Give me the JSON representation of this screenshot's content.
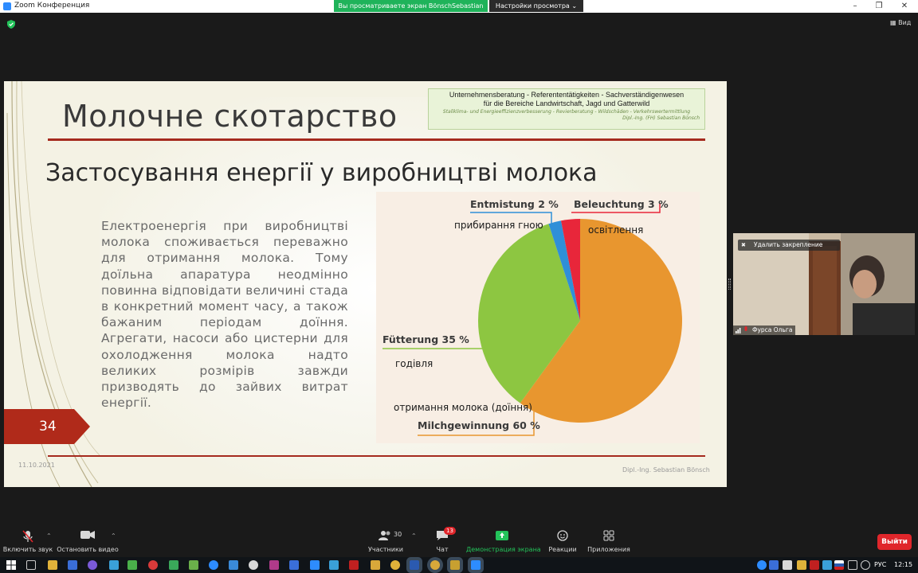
{
  "window": {
    "title": "Zoom Конференция",
    "share_banner": "Вы просматриваете экран BönschSebastian",
    "view_options": "Настройки просмотра",
    "view_label": "Вид"
  },
  "slide": {
    "title": "Молочне скотарство",
    "subtitle": "Застосування енергії у виробництві молока",
    "company": {
      "line1": "Unternehmensberatung  -  Referententätigkeiten  -  Sachverständigenwesen",
      "line2": "für die Bereiche Landwirtschaft, Jagd und Gatterwild",
      "line3": "Stallklima- und Energieeffizienzverbesserung - Revierberatung - Wildschäden - Verkehrswertermittlung",
      "line4": "Dipl.-Ing. (FH) Sebastian Bönsch"
    },
    "body": "Електроенергія при виробництві молока споживається переважно для отримання молока. Тому доїльна апаратура неодмінно повинна відповідати величині стада в конкретний момент часу, а також бажаним періодам доїння. Агрегати, насоси або цистерни для охолодження молока надто великих розмірів завжди призводять до зайвих витрат енергії.",
    "number": "34",
    "date": "11.10.2021",
    "author": "Dipl.-Ing. Sebastian Bönsch"
  },
  "chart_data": {
    "type": "pie",
    "slices": [
      {
        "label": "Milchgewinnung 60 %",
        "translation": "отримання молока (доїння)",
        "value": 60,
        "color": "#e8962f"
      },
      {
        "label": "Fütterung 35 %",
        "translation": "годівля",
        "value": 35,
        "color": "#8dc641"
      },
      {
        "label": "Entmistung  2 %",
        "translation": "прибирання гною",
        "value": 2,
        "color": "#2f8fd8"
      },
      {
        "label": "Beleuchtung 3 %",
        "translation": "освітлення",
        "value": 3,
        "color": "#e8263a"
      }
    ]
  },
  "participant": {
    "unpin_label": "Удалить закрепление",
    "name": "Фурса Ольга"
  },
  "controls": {
    "mute": "Включить звук",
    "video": "Остановить видео",
    "participants": "Участники",
    "participants_count": "30",
    "chat": "Чат",
    "chat_badge": "13",
    "share": "Демонстрация экрана",
    "reactions": "Реакции",
    "apps": "Приложения",
    "exit": "Выйти"
  },
  "taskbar": {
    "lang": "РУС",
    "time": "12:15"
  }
}
